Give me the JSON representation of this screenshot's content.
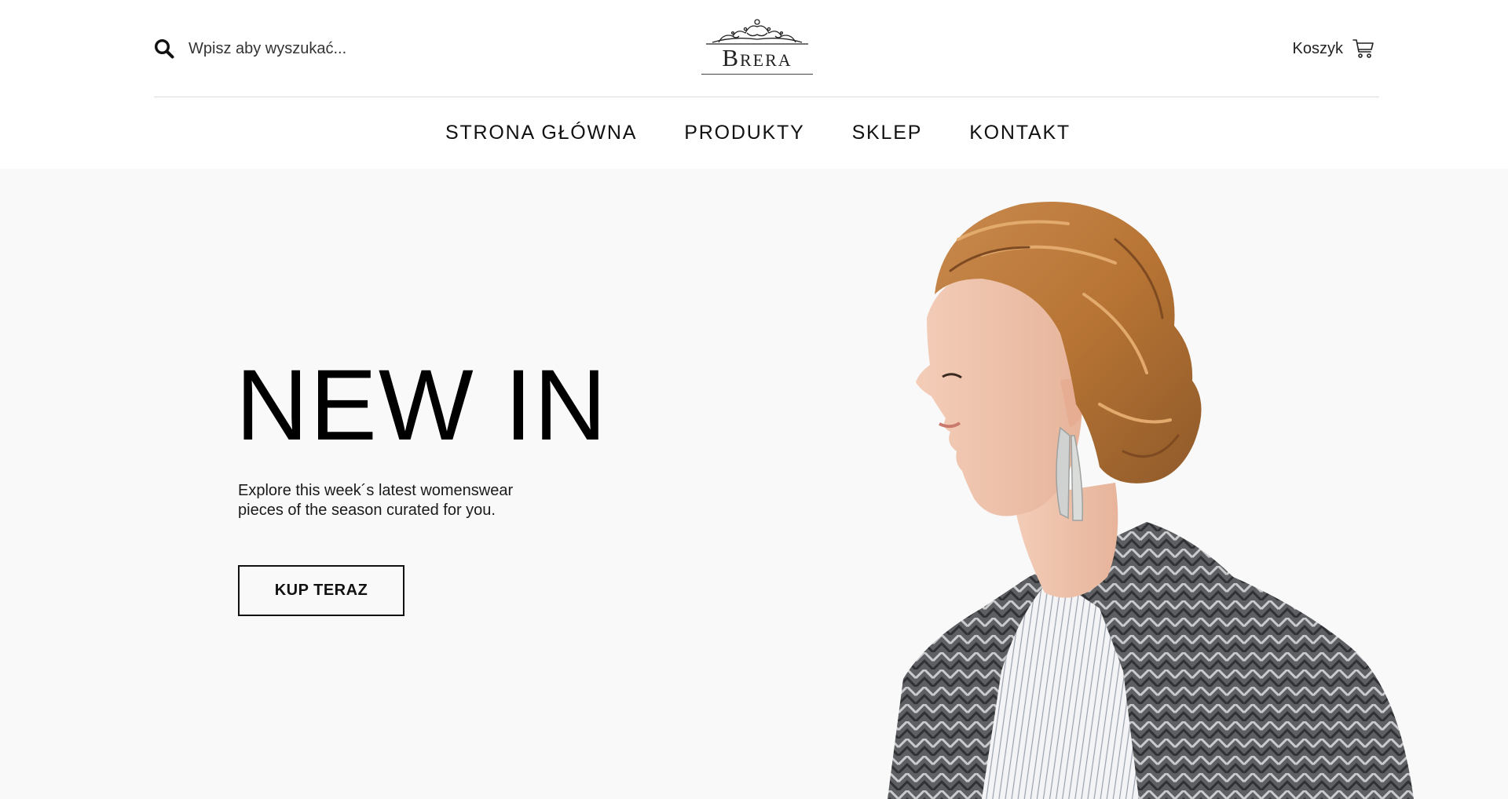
{
  "header": {
    "search": {
      "placeholder": "Wpisz aby wyszukać...",
      "icon": "search-icon"
    },
    "logo": {
      "text": "Brera"
    },
    "cart": {
      "label": "Koszyk",
      "icon": "cart-icon"
    }
  },
  "nav": {
    "items": [
      {
        "label": "STRONA GŁÓWNA"
      },
      {
        "label": "PRODUKTY"
      },
      {
        "label": "SKLEP"
      },
      {
        "label": "KONTAKT"
      }
    ]
  },
  "hero": {
    "title": "NEW IN",
    "description_line1": "Explore this week´s latest womenswear",
    "description_line2": "pieces of the season curated for you.",
    "cta_label": "KUP TERAZ"
  },
  "colors": {
    "text": "#111111",
    "hero_background": "#f9f9f9",
    "divider": "#dcdcdc"
  }
}
